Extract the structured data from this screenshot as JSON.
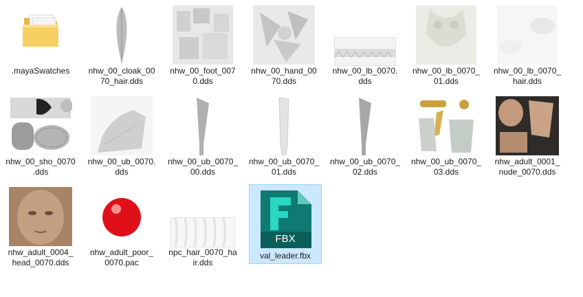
{
  "files": [
    {
      "name": "folder",
      "label": ".mayaSwatches",
      "icon": "folder-icon"
    },
    {
      "name": "cloak",
      "label": "nhw_00_cloak_00\n70_hair.dds",
      "icon": "feather-texture-thumbnail"
    },
    {
      "name": "foot",
      "label": "nhw_00_foot_007\n0.dds",
      "icon": "foot-texture-thumbnail"
    },
    {
      "name": "hand",
      "label": "nhw_00_hand_00\n70.dds",
      "icon": "hand-texture-thumbnail"
    },
    {
      "name": "lb",
      "label": "nhw_00_lb_0070.\ndds",
      "icon": "strip-texture-thumbnail"
    },
    {
      "name": "lb01",
      "label": "nhw_00_lb_0070_\n01.dds",
      "icon": "body-texture-thumbnail"
    },
    {
      "name": "lbhair",
      "label": "nhw_00_lb_0070_\nhair.dds",
      "icon": "hair-texture-thumbnail"
    },
    {
      "name": "sho",
      "label": "nhw_00_sho_0070\n.dds",
      "icon": "shoulder-texture-thumbnail"
    },
    {
      "name": "ub",
      "label": "nhw_00_ub_0070.\ndds",
      "icon": "cloth-texture-thumbnail"
    },
    {
      "name": "ub00",
      "label": "nhw_00_ub_0070_\n00.dds",
      "icon": "blade-texture-thumbnail"
    },
    {
      "name": "ub01",
      "label": "nhw_00_ub_0070_\n01.dds",
      "icon": "blade-texture-thumbnail"
    },
    {
      "name": "ub02",
      "label": "nhw_00_ub_0070_\n02.dds",
      "icon": "blade-texture-thumbnail"
    },
    {
      "name": "ub03",
      "label": "nhw_00_ub_0070_\n03.dds",
      "icon": "armor-texture-thumbnail"
    },
    {
      "name": "nude",
      "label": "nhw_adult_0001_\nnude_0070.dds",
      "icon": "skin-texture-thumbnail"
    },
    {
      "name": "head",
      "label": "nhw_adult_0004_\nhead_0070.dds",
      "icon": "face-texture-thumbnail"
    },
    {
      "name": "poor",
      "label": "nhw_adult_poor_\n0070.pac",
      "icon": "red-ball-icon"
    },
    {
      "name": "npchair",
      "label": "npc_hair_0070_ha\nir.dds",
      "icon": "hair-strands-thumbnail"
    },
    {
      "name": "fbx",
      "label": "val_leader.fbx",
      "icon": "fbx-icon",
      "badge": "FBX",
      "letter": "F",
      "selected": true
    }
  ]
}
